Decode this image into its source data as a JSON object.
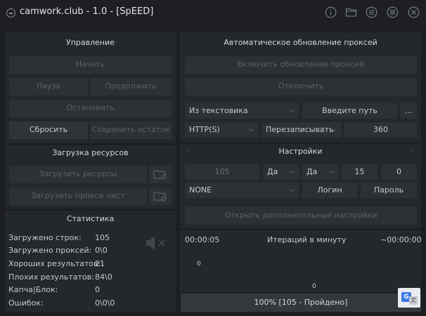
{
  "app": {
    "title": "camwork.club - 1.0 - [SpEED]"
  },
  "titlebar_icons": [
    "info-icon",
    "folder-icon",
    "list-icon",
    "menu-icon",
    "close-icon"
  ],
  "control": {
    "title": "Управление",
    "start": "Начать",
    "pause": "Пауза",
    "resume": "Продолжить",
    "stop": "Остановить",
    "reset": "Сбросить",
    "save_rest": "Сохранить остаток"
  },
  "resources": {
    "title": "Загрузка ресурсов",
    "load_resources": "Загрузить ресурсы",
    "load_proxy": "Загрузить прокси лист"
  },
  "stats": {
    "title": "Статистика",
    "rows": [
      {
        "label": "Загружено строк:",
        "value": "105"
      },
      {
        "label": "Загружено проксей:",
        "value": "0\\0"
      },
      {
        "label": "Хороших результатов:",
        "value": "21"
      },
      {
        "label": "Плохих результатов:",
        "value": "84\\0"
      },
      {
        "label": "Капча|Блок:",
        "value": "0"
      },
      {
        "label": "Ошибок:",
        "value": "0\\0\\0"
      }
    ]
  },
  "proxy_update": {
    "title": "Автоматическое обновление проксей",
    "enable": "Включить обновление проксей",
    "disable": "Отключить",
    "source_select": "Из текстовика",
    "path_placeholder": "Введите путь",
    "browse": "...",
    "type_select": "HTTP(S)",
    "mode_select": "Перезаписывать",
    "interval": "360"
  },
  "settings": {
    "title": "Настройки",
    "threads": "105",
    "opt1": "Да",
    "opt2": "Да",
    "timeout": "15",
    "retries": "0",
    "auth_select": "NONE",
    "login": "Логин",
    "password": "Пароль",
    "advanced": "Открыть дополнительные настройки"
  },
  "graph": {
    "time_left": "00:00:05",
    "title": "Итераций в минуту",
    "time_right": "~00:00:00",
    "y_value": "0",
    "x_value": "0"
  },
  "progress": {
    "text": "100% [105 - Пройдено]",
    "percent": 100
  },
  "colors": {
    "background": "#1c1e22",
    "panel": "#24272b",
    "button": "#2d3034",
    "text": "#c8cacd",
    "disabled_text": "#5d6166"
  }
}
